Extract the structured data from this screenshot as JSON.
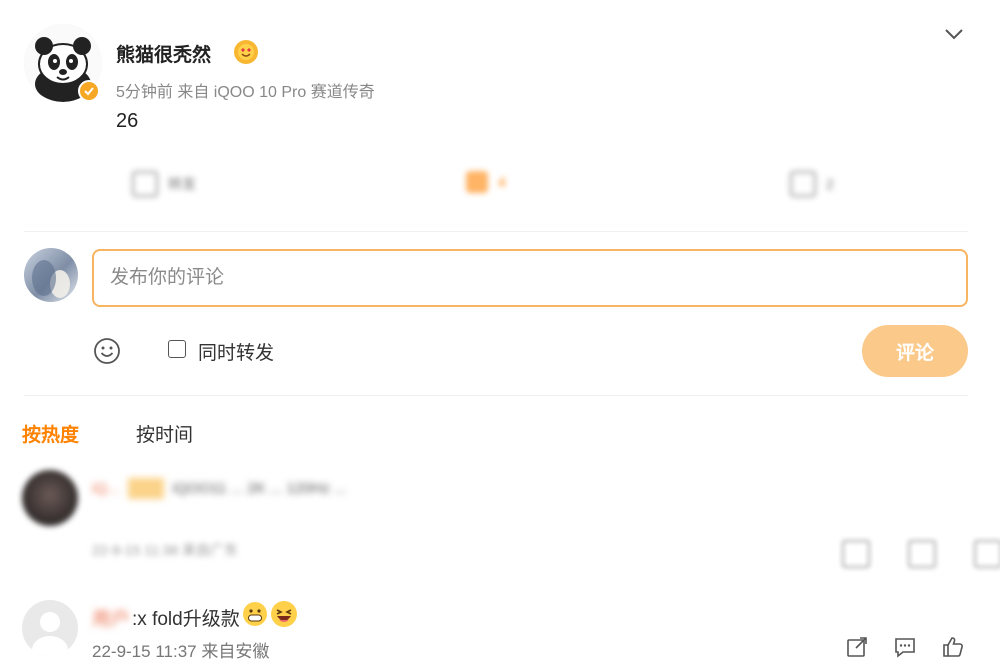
{
  "post": {
    "author": "熊猫很秃然",
    "meta": "5分钟前 来自 iQOO 10 Pro 赛道传奇",
    "text": "26"
  },
  "actions": {
    "repost_label": "转发",
    "comment_count": "4",
    "like_count": "2"
  },
  "composer": {
    "placeholder": "发布你的评论",
    "repost_label": "同时转发",
    "submit_label": "评论"
  },
  "sort_tabs": {
    "hot": "按热度",
    "time": "按时间"
  },
  "comments": [
    {
      "user": "iQ...",
      "text": "iQOO11 ... 2K ... 120Hz ...",
      "meta": "22-9-15 11:38 来自广东"
    },
    {
      "user": "用户",
      "text_suffix": ":x fold升级款",
      "meta": "22-9-15 11:37 来自安徽"
    }
  ],
  "colors": {
    "accent": "#ff8200",
    "input_border": "#f7b461",
    "submit_bg": "#fbc98a",
    "verified": "#f6a723"
  }
}
